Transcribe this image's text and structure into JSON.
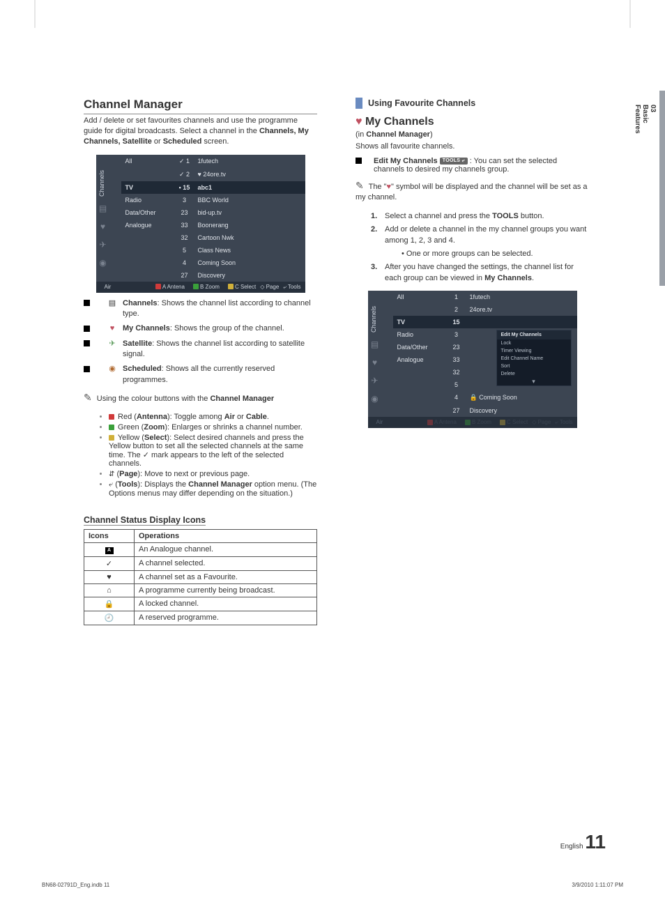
{
  "sidebar": {
    "section_no": "03",
    "section_title": "Basic Features"
  },
  "footer": {
    "doc": "BN68-02791D_Eng.indb   11",
    "date": "3/9/2010   1:11:07 PM"
  },
  "page_footer": {
    "lang": "English",
    "page_no": "11"
  },
  "left": {
    "h2": "Channel Manager",
    "intro_pre": "Add / delete or set favourites channels and use the programme guide for digital broadcasts. Select a channel in the ",
    "intro_bold": "Channels, My Channels, Satellite",
    "intro_mid": " or ",
    "intro_bold2": "Scheduled",
    "intro_post": " screen.",
    "tv1": {
      "side_label": "Channels",
      "rows_top": [
        {
          "c1": "All",
          "c2": "✓ 1",
          "c3": "1futech"
        },
        {
          "c1": "",
          "c2": "✓ 2",
          "c3": "♥ 24ore.tv"
        }
      ],
      "row_sel": {
        "c1": "TV",
        "c2": "• 15",
        "c3": "abc1"
      },
      "rows_bottom": [
        {
          "c1": "Radio",
          "c2": "3",
          "c3": "BBC World"
        },
        {
          "c1": "Data/Other",
          "c2": "23",
          "c3": "bid-up.tv"
        },
        {
          "c1": "Analogue",
          "c2": "33",
          "c3": "Boonerang"
        },
        {
          "c1": "",
          "c2": "32",
          "c3": "Cartoon Nwk"
        },
        {
          "c1": "",
          "c2": "5",
          "c3": "Class News"
        },
        {
          "c1": "",
          "c2": "4",
          "c3": "Coming Soon"
        },
        {
          "c1": "",
          "c2": "27",
          "c3": "Discovery"
        }
      ],
      "bar_left": "Air",
      "bar_items": [
        "A Antena",
        "B Zoom",
        "C Select",
        "◇ Page",
        "⤶ Tools"
      ]
    },
    "desc1_bold": "Channels",
    "desc1_txt": ": Shows the channel list according to channel type.",
    "desc2_bold": "My Channels",
    "desc2_txt": ": Shows the group of the channel.",
    "desc3_bold": "Satellite",
    "desc3_txt": ": Shows the channel list according to satellite signal.",
    "desc4_bold": "Scheduled",
    "desc4_txt": ": Shows all the currently reserved programmes.",
    "note_txt": "Using the colour buttons with the ",
    "note_bold": "Channel Manager",
    "sub": [
      {
        "pre": "Red (",
        "b": "Antenna",
        "post": "): Toggle among ",
        "b2": "Air",
        "mid": " or ",
        "b3": "Cable",
        "end": ".",
        "ic": "r"
      },
      {
        "pre": "Green (",
        "b": "Zoom",
        "post": "): Enlarges or shrinks a channel number.",
        "ic": "g"
      },
      {
        "pre": "Yellow (",
        "b": "Select",
        "post": "): Select desired channels and press the Yellow button to set all the selected channels at the same time. The ✓ mark appears to the left of the selected channels.",
        "ic": "y"
      },
      {
        "pre": "(",
        "b": "Page",
        "post": "): Move to next or previous page.",
        "ic": "ud"
      },
      {
        "pre": "(",
        "b": "Tools",
        "post": "): Displays the ",
        "b2": "Channel Manager",
        "end": " option menu. (The Options menus may differ depending on the situation.)",
        "ic": "tl"
      }
    ],
    "table_title": "Channel Status Display Icons",
    "th1": "Icons",
    "th2": "Operations",
    "tbl": [
      {
        "ic": "A",
        "op": "An Analogue channel."
      },
      {
        "ic": "✓",
        "op": "A channel selected."
      },
      {
        "ic": "♥",
        "op": "A channel set as a Favourite."
      },
      {
        "ic": "⧈",
        "op": "A programme currently being broadcast."
      },
      {
        "ic": "🔒",
        "op": "A locked channel."
      },
      {
        "ic": "🕘",
        "op": "A reserved programme."
      }
    ]
  },
  "right": {
    "bar_title": "Using Favourite Channels",
    "h3": "My Channels",
    "sub1_pre": "(in ",
    "sub1_bold": "Channel Manager",
    "sub1_post": ")",
    "sub2": "Shows all favourite channels.",
    "edit_bold": "Edit My Channels",
    "tools_badge": "TOOLS ⤶",
    "edit_txt": " : You can set the selected channels to desired my channels group.",
    "note_pre": "The \"",
    "note_sym": "♥",
    "note_post": "\" symbol will be displayed and the channel will be set as a my channel.",
    "steps": [
      {
        "n": "1.",
        "t_pre": "Select a channel and press the ",
        "t_bold": "TOOLS",
        "t_post": " button."
      },
      {
        "n": "2.",
        "t": "Add or delete a channel in the my channel groups you want among 1, 2, 3 and 4."
      },
      {
        "n_sub": "• One or more groups can be selected."
      },
      {
        "n": "3.",
        "t_pre": "After you have changed the settings, the channel list for each group can be viewed in ",
        "t_bold": "My Channels",
        "t_post": "."
      }
    ],
    "tv2": {
      "side_label": "Channels",
      "rows_top": [
        {
          "c1": "All",
          "c2": "1",
          "c3": "1futech"
        },
        {
          "c1": "",
          "c2": "2",
          "c3": "24ore.tv"
        }
      ],
      "row_sel": {
        "c1": "TV",
        "c2": "15",
        "c3_menu": true
      },
      "rows_bottom": [
        {
          "c1": "Radio",
          "c2": "3",
          "c3": ""
        },
        {
          "c1": "Data/Other",
          "c2": "23",
          "c3": ""
        },
        {
          "c1": "Analogue",
          "c2": "33",
          "c3": ""
        },
        {
          "c1": "",
          "c2": "32",
          "c3": ""
        },
        {
          "c1": "",
          "c2": "5",
          "c3": ""
        },
        {
          "c1": "",
          "c2": "4",
          "c3": "🔒  Coming Soon"
        },
        {
          "c1": "",
          "c2": "27",
          "c3": "     Discovery"
        }
      ],
      "menu_header": "Edit My Channels",
      "menu_items": [
        "Lock",
        "Timer Viewing",
        "Edit Channel Name",
        "Sort",
        "Delete"
      ],
      "bar_left": "Air",
      "bar_items": [
        "A Antena",
        "B Zoom",
        "C Select",
        "◇ Page",
        "⤶ Tools"
      ]
    }
  }
}
